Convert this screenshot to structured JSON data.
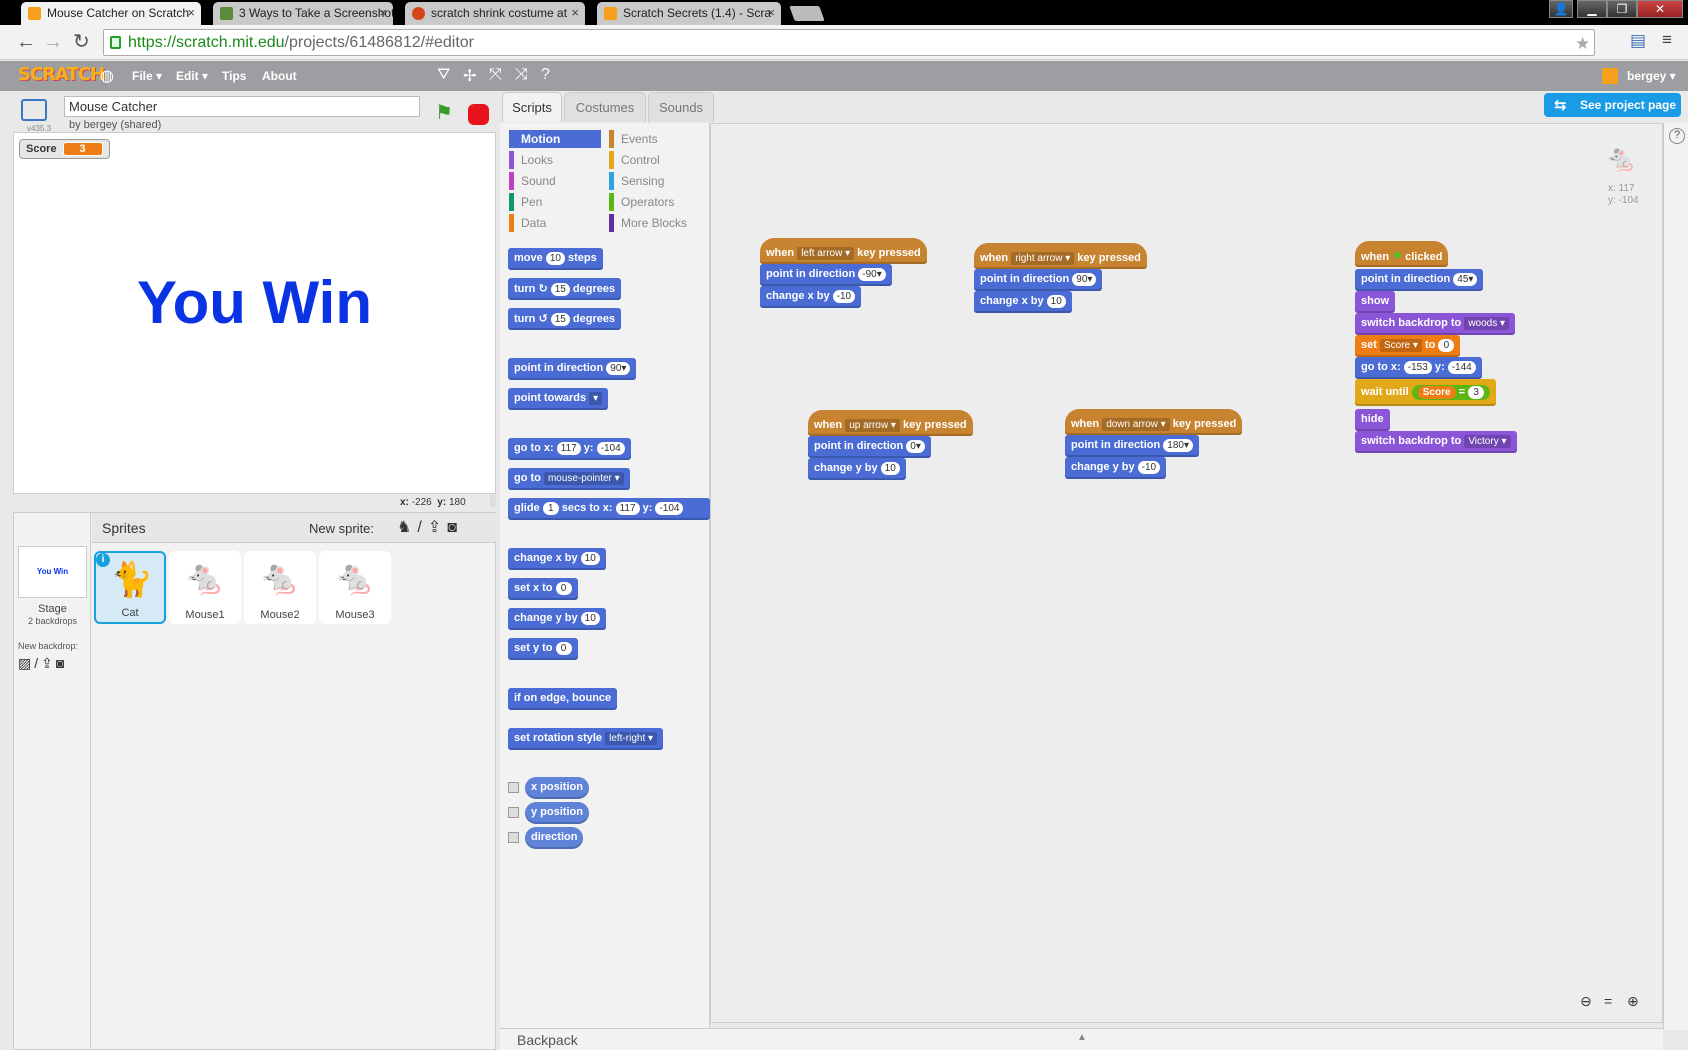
{
  "browser": {
    "tabs": [
      {
        "title": "Mouse Catcher on Scratch",
        "active": true
      },
      {
        "title": "3 Ways to Take a Screenshot",
        "active": false
      },
      {
        "title": "scratch shrink costume at",
        "active": false
      },
      {
        "title": "Scratch Secrets (1.4) - Scra",
        "active": false
      }
    ],
    "url_host": "https://scratch.mit.edu",
    "url_path": "/projects/61486812/#editor",
    "close_glyph": "×"
  },
  "menubar": {
    "logo": "SCRATCH",
    "file": "File ▾",
    "edit": "Edit ▾",
    "tips": "Tips",
    "about": "About",
    "user": "bergey ▾"
  },
  "stage": {
    "version": "v435.3",
    "project_title": "Mouse Catcher",
    "byline": "by bergey (shared)",
    "monitor_label": "Score",
    "monitor_value": "3",
    "text": "You Win",
    "mouse_x_label": "x:",
    "mouse_x": "-226",
    "mouse_y_label": "y:",
    "mouse_y": "180"
  },
  "sprites": {
    "header": "Sprites",
    "new_sprite": "New sprite:",
    "stage_label": "Stage",
    "stage_sub": "2 backdrops",
    "stage_thumb": "You Win",
    "new_backdrop": "New backdrop:",
    "items": [
      {
        "name": "Cat"
      },
      {
        "name": "Mouse1"
      },
      {
        "name": "Mouse2"
      },
      {
        "name": "Mouse3"
      }
    ]
  },
  "tabs": {
    "scripts": "Scripts",
    "costumes": "Costumes",
    "sounds": "Sounds",
    "see_project": "See project page"
  },
  "categories": [
    {
      "label": "Motion",
      "color": "#4a6cd4"
    },
    {
      "label": "Events",
      "color": "#c88330"
    },
    {
      "label": "Looks",
      "color": "#8a55d7"
    },
    {
      "label": "Control",
      "color": "#e1a91a"
    },
    {
      "label": "Sound",
      "color": "#bb42c3"
    },
    {
      "label": "Sensing",
      "color": "#2ca5e2"
    },
    {
      "label": "Pen",
      "color": "#0e9a6c"
    },
    {
      "label": "Operators",
      "color": "#5cb712"
    },
    {
      "label": "Data",
      "color": "#ee7d16"
    },
    {
      "label": "More Blocks",
      "color": "#632d99"
    }
  ],
  "palette": {
    "move": "move",
    "move_v": "10",
    "steps": "steps",
    "turn": "turn",
    "turn_v": "15",
    "degrees": "degrees",
    "point_dir": "point in direction",
    "point_dir_v": "90▾",
    "point_towards": "point towards",
    "towards_v": "▾",
    "goto_xy": "go to x:",
    "goto_x": "117",
    "goto_y_lbl": "y:",
    "goto_y": "-104",
    "goto": "go to",
    "goto_v": "mouse-pointer ▾",
    "glide": "glide",
    "glide_v": "1",
    "glide_mid": "secs to x:",
    "glide_x": "117",
    "glide_y_lbl": "y:",
    "glide_y": "-104",
    "change_x": "change x by",
    "change_x_v": "10",
    "set_x": "set x to",
    "set_x_v": "0",
    "change_y": "change y by",
    "change_y_v": "10",
    "set_y": "set y to",
    "set_y_v": "0",
    "bounce": "if on edge, bounce",
    "rot": "set rotation style",
    "rot_v": "left-right ▾",
    "xpos": "x position",
    "ypos": "y position",
    "direction": "direction"
  },
  "scripts": {
    "when": "when",
    "key_pressed": "key pressed",
    "clicked": "clicked",
    "left": "left arrow ▾",
    "right": "right arrow ▾",
    "up": "up arrow ▾",
    "down": "down arrow ▾",
    "point_dir": "point in direction",
    "change_x": "change x by",
    "change_y": "change y by",
    "v_m90": "-90▾",
    "v_90": "90▾",
    "v_0": "0▾",
    "v_180": "180▾",
    "v_45": "45▾",
    "v_m10": "-10",
    "v_10": "10",
    "show": "show",
    "switch_bd": "switch backdrop to",
    "woods": "woods ▾",
    "victory": "Victory ▾",
    "set": "set",
    "score_var": "Score ▾",
    "to": "to",
    "set_v": "0",
    "goto_xy": "go to x:",
    "gx": "-153",
    "gy_lbl": "y:",
    "gy": "-144",
    "wait_until": "wait until",
    "score": "Score",
    "eq": "=",
    "eq_v": "3",
    "hide": "hide",
    "sprite_x": "x: 117",
    "sprite_y": "y: -104"
  },
  "backpack": "Backpack"
}
